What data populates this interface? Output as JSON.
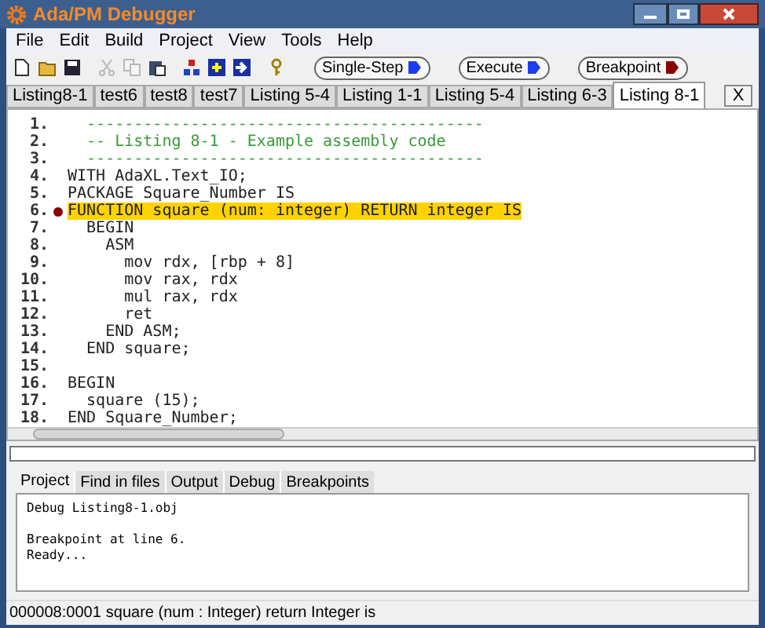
{
  "window": {
    "title": "Ada/PM Debugger"
  },
  "menu": [
    "File",
    "Edit",
    "Build",
    "Project",
    "View",
    "Tools",
    "Help"
  ],
  "toolbar": {
    "icons": [
      {
        "kind": "new",
        "disabled": false
      },
      {
        "kind": "open",
        "disabled": false
      },
      {
        "kind": "save",
        "disabled": false
      },
      {
        "kind": "cut",
        "disabled": true
      },
      {
        "kind": "copy",
        "disabled": true
      },
      {
        "kind": "paste",
        "disabled": false
      },
      {
        "kind": "blocks",
        "disabled": false
      },
      {
        "kind": "stepin",
        "disabled": false
      },
      {
        "kind": "stepout",
        "disabled": false
      },
      {
        "kind": "key",
        "disabled": false
      }
    ],
    "buttons": [
      {
        "label": "Single-Step",
        "color": "#1e3cf0"
      },
      {
        "label": "Execute",
        "color": "#1e3cf0"
      },
      {
        "label": "Breakpoint",
        "color": "#8b0000"
      }
    ]
  },
  "tabs": [
    {
      "label": "Listing8-1",
      "selected": false
    },
    {
      "label": "test6",
      "selected": false
    },
    {
      "label": "test8",
      "selected": false
    },
    {
      "label": "test7",
      "selected": false
    },
    {
      "label": "Listing 5-4",
      "selected": false
    },
    {
      "label": "Listing 1-1",
      "selected": false
    },
    {
      "label": "Listing 5-4",
      "selected": false
    },
    {
      "label": "Listing 6-3",
      "selected": false
    },
    {
      "label": "Listing 8-1",
      "selected": true
    }
  ],
  "close_tab": "X",
  "editor": {
    "lines": [
      {
        "number": "1.",
        "text": "  ------------------------------------------",
        "kind": "comment",
        "breakpoint": false,
        "highlighted": false
      },
      {
        "number": "2.",
        "text": "  -- Listing 8-1 - Example assembly code",
        "kind": "comment",
        "breakpoint": false,
        "highlighted": false
      },
      {
        "number": "3.",
        "text": "  ------------------------------------------",
        "kind": "comment",
        "breakpoint": false,
        "highlighted": false
      },
      {
        "number": "4.",
        "text": "WITH AdaXL.Text_IO;",
        "kind": "code",
        "breakpoint": false,
        "highlighted": false
      },
      {
        "number": "5.",
        "text": "PACKAGE Square_Number IS",
        "kind": "code",
        "breakpoint": false,
        "highlighted": false
      },
      {
        "number": "6.",
        "text": "FUNCTION square (num: integer) RETURN integer IS",
        "kind": "code",
        "breakpoint": true,
        "highlighted": true
      },
      {
        "number": "7.",
        "text": "  BEGIN",
        "kind": "code",
        "breakpoint": false,
        "highlighted": false
      },
      {
        "number": "8.",
        "text": "    ASM",
        "kind": "code",
        "breakpoint": false,
        "highlighted": false
      },
      {
        "number": "9.",
        "text": "      mov rdx, [rbp + 8]",
        "kind": "code",
        "breakpoint": false,
        "highlighted": false
      },
      {
        "number": "10.",
        "text": "      mov rax, rdx",
        "kind": "code",
        "breakpoint": false,
        "highlighted": false
      },
      {
        "number": "11.",
        "text": "      mul rax, rdx",
        "kind": "code",
        "breakpoint": false,
        "highlighted": false
      },
      {
        "number": "12.",
        "text": "      ret",
        "kind": "code",
        "breakpoint": false,
        "highlighted": false
      },
      {
        "number": "13.",
        "text": "    END ASM;",
        "kind": "code",
        "breakpoint": false,
        "highlighted": false
      },
      {
        "number": "14.",
        "text": "  END square;",
        "kind": "code",
        "breakpoint": false,
        "highlighted": false
      },
      {
        "number": "15.",
        "breakpoint": false,
        "highlighted": false
      },
      {
        "number": "16.",
        "text": "BEGIN",
        "kind": "code",
        "breakpoint": false,
        "highlighted": false
      },
      {
        "number": "17.",
        "text": "  square (15);",
        "kind": "code",
        "breakpoint": false,
        "highlighted": false
      },
      {
        "number": "18.",
        "text": "END Square_Number;",
        "kind": "code",
        "breakpoint": false,
        "highlighted": false
      }
    ]
  },
  "output_tabs": [
    {
      "label": "Project",
      "selected": true
    },
    {
      "label": "Find in files",
      "selected": false
    },
    {
      "label": "Output",
      "selected": false
    },
    {
      "label": "Debug",
      "selected": false
    },
    {
      "label": "Breakpoints",
      "selected": false
    }
  ],
  "output": {
    "paragraphs": [
      [
        "Debug Listing8-1.obj"
      ],
      [
        "Breakpoint at line 6.",
        "Ready..."
      ]
    ]
  },
  "status_bar": {
    "position": "000008:0001",
    "text": "square (num : Integer) return Integer is"
  }
}
